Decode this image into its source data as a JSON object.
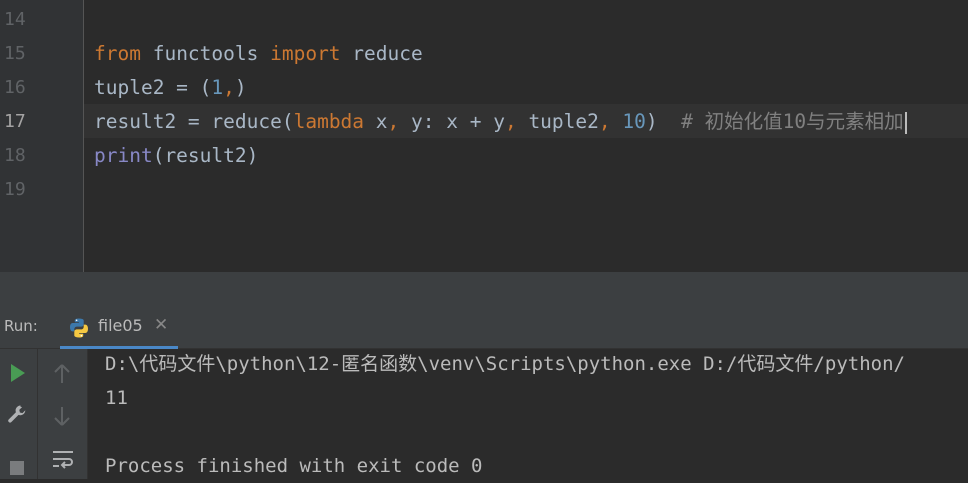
{
  "editor": {
    "line_numbers": [
      "14",
      "15",
      "16",
      "17",
      "18",
      "19"
    ],
    "current_line": "17",
    "lines": {
      "l15": {
        "kw1": "from",
        "t1": " functools ",
        "kw2": "import",
        "t2": " reduce"
      },
      "l16": {
        "t1": "tuple2 = (",
        "n1": "1",
        "p1": ",",
        "t2": ")"
      },
      "l17": {
        "t1": "result2 = reduce(",
        "kw1": "lambda",
        "t2": " x",
        "p1": ",",
        "t3": " y: x + y",
        "p2": ",",
        "t4": " tuple2",
        "p3": ",",
        "t5": " ",
        "n1": "10",
        "t6": ")  ",
        "c1": "# 初始化值10与元素相加"
      },
      "l18": {
        "f1": "print",
        "t1": "(result2)"
      }
    }
  },
  "run_panel": {
    "label": "Run:",
    "tab_label": "file05",
    "tab_close": "✕",
    "icons": [
      "python-file-icon",
      "run-icon",
      "wrench-icon",
      "stop-icon",
      "up-arrow-icon",
      "down-arrow-icon",
      "soft-wrap-icon"
    ]
  },
  "console": {
    "lines": [
      "D:\\代码文件\\python\\12-匿名函数\\venv\\Scripts\\python.exe D:/代码文件/python/",
      "11",
      "",
      "Process finished with exit code 0"
    ]
  },
  "colors": {
    "keyword": "#cc7832",
    "builtin": "#8888c6",
    "number": "#6897bb",
    "comment": "#808080",
    "text": "#a9b7c6",
    "run_green": "#499c54",
    "tab_underline": "#4a88c7"
  }
}
